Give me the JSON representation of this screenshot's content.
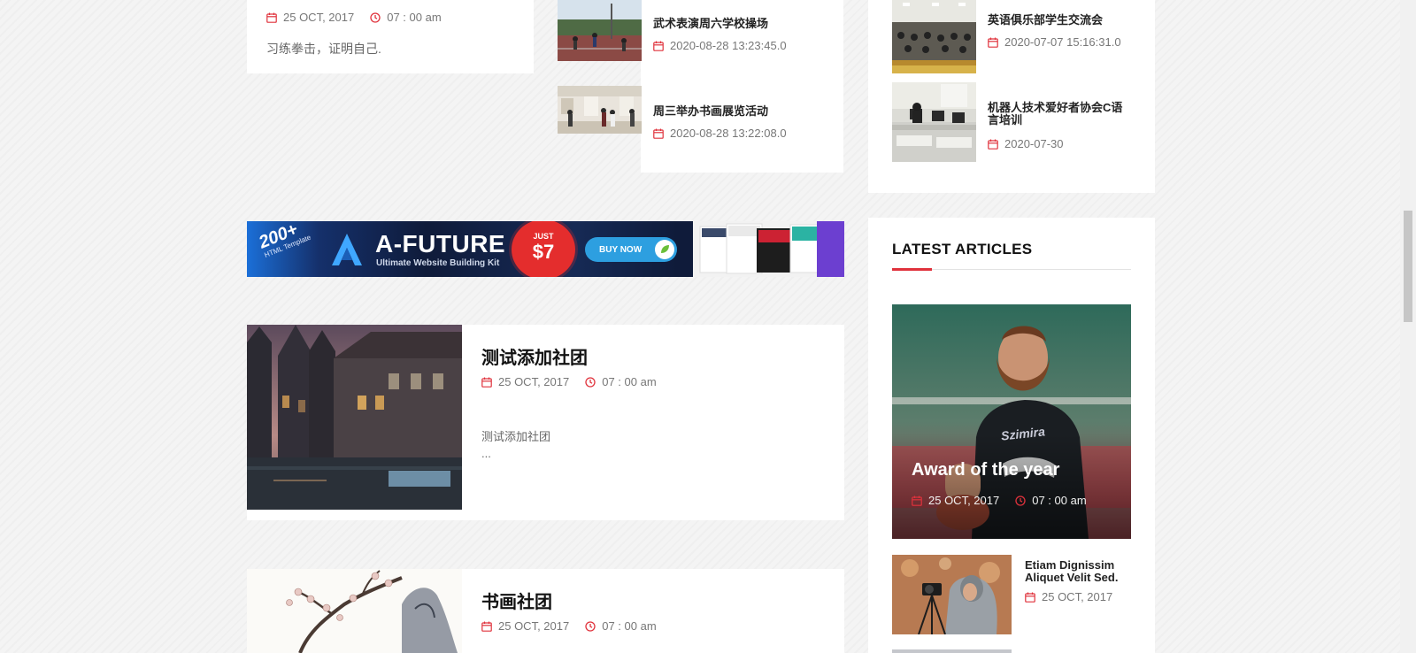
{
  "colors": {
    "accent": "#e0323c",
    "heading": "#111111",
    "meta": "#777777",
    "banner_bg": "#0f1b3a",
    "banner_badge": "#e42d2d",
    "banner_btn": "#2d9fe0"
  },
  "icons": {
    "date": "calendar-icon",
    "time": "clock-icon"
  },
  "top_card": {
    "date": "25 OCT, 2017",
    "time": "07 : 00 am",
    "excerpt": "习练拳击，证明自己."
  },
  "mid_list": [
    {
      "title": "武术表演周六学校操场",
      "date": "2020-08-28 13:23:45.0"
    },
    {
      "title": "周三举办书画展览活动",
      "date": "2020-08-28 13:22:08.0"
    }
  ],
  "right_list": [
    {
      "title": "英语俱乐部学生交流会",
      "date": "2020-07-07 15:16:31.0"
    },
    {
      "title": "机器人技术爱好者协会C语言培训",
      "date": "2020-07-30"
    }
  ],
  "banner": {
    "count": "200+",
    "subtitle_tag": "HTML Template",
    "brand": "A-FUTURE",
    "tagline": "Ultimate Website Building Kit",
    "price_prefix": "JUST",
    "price": "$7",
    "button": "BUY NOW"
  },
  "posts": [
    {
      "title": "测试添加社团",
      "date": "25 OCT, 2017",
      "time": "07 : 00 am",
      "excerpt": "测试添加社团",
      "more": "..."
    },
    {
      "title": "书画社团",
      "date": "25 OCT, 2017",
      "time": "07 : 00 am"
    }
  ],
  "latest": {
    "heading": "LATEST ARTICLES",
    "featured": {
      "title": "Award of the year",
      "date": "25 OCT, 2017",
      "time": "07 : 00 am",
      "jersey": "Szimira"
    },
    "items": [
      {
        "title": "Etiam Dignissim Aliquet Velit Sed.",
        "date": "25 OCT, 2017"
      }
    ]
  }
}
